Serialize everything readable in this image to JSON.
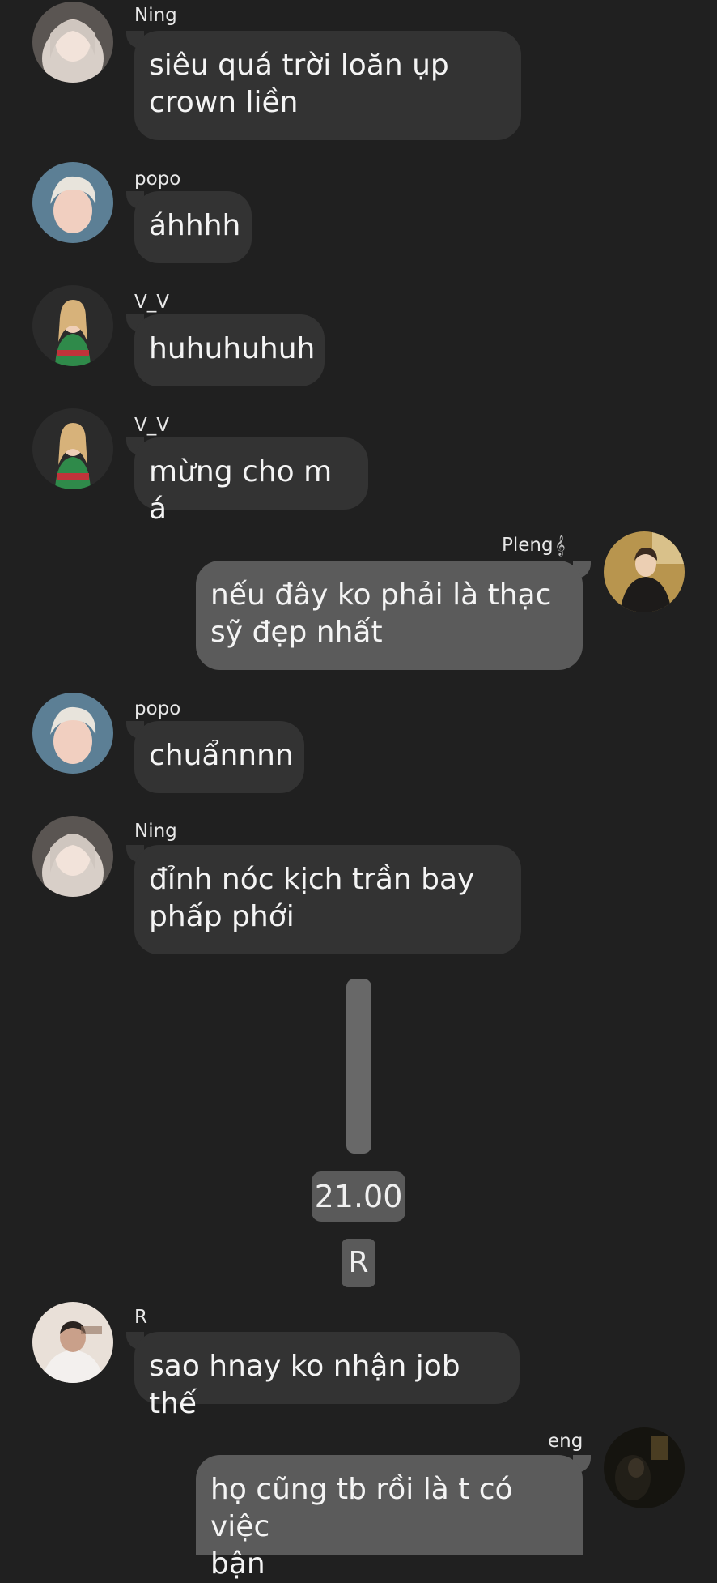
{
  "messages": [
    {
      "sender": "Ning",
      "text": "siêu quá trời loăn ụp\ncrown liền"
    },
    {
      "sender": "popo",
      "text": "áhhhh"
    },
    {
      "sender": "V_V",
      "text": "huhuhuhuh"
    },
    {
      "sender": "V_V",
      "text": "mừng cho m á"
    },
    {
      "sender": "Pleng",
      "text": "nếu đây ko phải là thạc\nsỹ đẹp nhất"
    },
    {
      "sender": "popo",
      "text": "chuẩnnnn"
    },
    {
      "sender": "Ning",
      "text": "đỉnh nóc kịch trần bay\nphấp phới"
    },
    {
      "sender": "R",
      "text": "sao hnay ko nhận job thế"
    },
    {
      "sender": "eng",
      "text": "họ cũng tb rồi là t có việc\nbận"
    }
  ],
  "time_marker": "21.00",
  "letter_marker": "R",
  "icons": {
    "pleng_name_icon": "music-note-icon"
  },
  "colors": {
    "background": "#202020",
    "incoming_bubble": "#333333",
    "outgoing_bubble": "#5b5b5b",
    "scrollbar": "#686868"
  }
}
